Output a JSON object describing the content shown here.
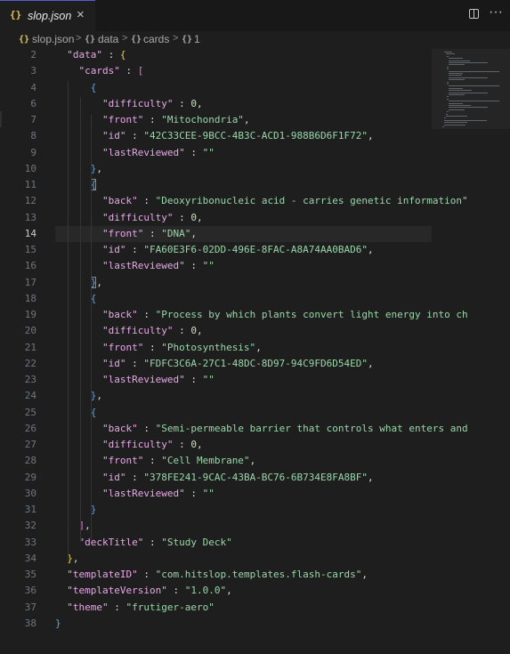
{
  "tab": {
    "icon": "{}",
    "label": "slop.json",
    "close_glyph": "×"
  },
  "toolbar": {
    "split_editor_icon": "split-editor-icon",
    "more_actions_glyph": "···"
  },
  "breadcrumb": {
    "file": "slop.json",
    "items": [
      "data",
      "cards",
      "1"
    ],
    "separator": ">",
    "object_icon": "{}"
  },
  "editor": {
    "active_line": 14,
    "lines": [
      {
        "n": "2",
        "tokens": [
          {
            "t": "  ",
            "c": "p"
          },
          {
            "t": "\"data\"",
            "c": "k"
          },
          {
            "t": " : ",
            "c": "p"
          },
          {
            "t": "{",
            "c": "g1"
          }
        ]
      },
      {
        "n": "3",
        "tokens": [
          {
            "t": "    ",
            "c": "p"
          },
          {
            "t": "\"cards\"",
            "c": "k"
          },
          {
            "t": " : ",
            "c": "p"
          },
          {
            "t": "[",
            "c": "g2"
          }
        ]
      },
      {
        "n": "4",
        "tokens": [
          {
            "t": "      ",
            "c": "p"
          },
          {
            "t": "{",
            "c": "g3"
          }
        ]
      },
      {
        "n": "6",
        "tokens": [
          {
            "t": "        ",
            "c": "p"
          },
          {
            "t": "\"difficulty\"",
            "c": "k"
          },
          {
            "t": " : ",
            "c": "p"
          },
          {
            "t": "0",
            "c": "n"
          },
          {
            "t": ",",
            "c": "p"
          }
        ]
      },
      {
        "n": "7",
        "tokens": [
          {
            "t": "        ",
            "c": "p"
          },
          {
            "t": "\"front\"",
            "c": "k"
          },
          {
            "t": " : ",
            "c": "p"
          },
          {
            "t": "\"Mitochondria\"",
            "c": "s"
          },
          {
            "t": ",",
            "c": "p"
          }
        ]
      },
      {
        "n": "8",
        "tokens": [
          {
            "t": "        ",
            "c": "p"
          },
          {
            "t": "\"id\"",
            "c": "k"
          },
          {
            "t": " : ",
            "c": "p"
          },
          {
            "t": "\"42C33CEE-9BCC-4B3C-ACD1-988B6D6F1F72\"",
            "c": "s"
          },
          {
            "t": ",",
            "c": "p"
          }
        ]
      },
      {
        "n": "9",
        "tokens": [
          {
            "t": "        ",
            "c": "p"
          },
          {
            "t": "\"lastReviewed\"",
            "c": "k"
          },
          {
            "t": " : ",
            "c": "p"
          },
          {
            "t": "\"\"",
            "c": "s"
          }
        ]
      },
      {
        "n": "10",
        "tokens": [
          {
            "t": "      ",
            "c": "p"
          },
          {
            "t": "}",
            "c": "g3"
          },
          {
            "t": ",",
            "c": "p"
          }
        ]
      },
      {
        "n": "11",
        "tokens": [
          {
            "t": "      ",
            "c": "p"
          },
          {
            "t": "{",
            "c": "g3 bm"
          }
        ]
      },
      {
        "n": "12",
        "tokens": [
          {
            "t": "        ",
            "c": "p"
          },
          {
            "t": "\"back\"",
            "c": "k"
          },
          {
            "t": " : ",
            "c": "p"
          },
          {
            "t": "\"Deoxyribonucleic acid - carries genetic information\"",
            "c": "s"
          }
        ]
      },
      {
        "n": "13",
        "tokens": [
          {
            "t": "        ",
            "c": "p"
          },
          {
            "t": "\"difficulty\"",
            "c": "k"
          },
          {
            "t": " : ",
            "c": "p"
          },
          {
            "t": "0",
            "c": "n"
          },
          {
            "t": ",",
            "c": "p"
          }
        ]
      },
      {
        "n": "14",
        "tokens": [
          {
            "t": "        ",
            "c": "p"
          },
          {
            "t": "\"front\"",
            "c": "k"
          },
          {
            "t": " : ",
            "c": "p"
          },
          {
            "t": "\"DNA\"",
            "c": "s"
          },
          {
            "t": ",",
            "c": "p"
          }
        ]
      },
      {
        "n": "15",
        "tokens": [
          {
            "t": "        ",
            "c": "p"
          },
          {
            "t": "\"id\"",
            "c": "k"
          },
          {
            "t": " : ",
            "c": "p"
          },
          {
            "t": "\"FA60E3F6-02DD-496E-8FAC-A8A74AA0BAD6\"",
            "c": "s"
          },
          {
            "t": ",",
            "c": "p"
          }
        ]
      },
      {
        "n": "16",
        "tokens": [
          {
            "t": "        ",
            "c": "p"
          },
          {
            "t": "\"lastReviewed\"",
            "c": "k"
          },
          {
            "t": " : ",
            "c": "p"
          },
          {
            "t": "\"\"",
            "c": "s"
          }
        ]
      },
      {
        "n": "17",
        "tokens": [
          {
            "t": "      ",
            "c": "p"
          },
          {
            "t": "}",
            "c": "g3 bm"
          },
          {
            "t": ",",
            "c": "p"
          }
        ]
      },
      {
        "n": "18",
        "tokens": [
          {
            "t": "      ",
            "c": "p"
          },
          {
            "t": "{",
            "c": "g3"
          }
        ]
      },
      {
        "n": "19",
        "tokens": [
          {
            "t": "        ",
            "c": "p"
          },
          {
            "t": "\"back\"",
            "c": "k"
          },
          {
            "t": " : ",
            "c": "p"
          },
          {
            "t": "\"Process by which plants convert light energy into ch",
            "c": "s"
          }
        ]
      },
      {
        "n": "20",
        "tokens": [
          {
            "t": "        ",
            "c": "p"
          },
          {
            "t": "\"difficulty\"",
            "c": "k"
          },
          {
            "t": " : ",
            "c": "p"
          },
          {
            "t": "0",
            "c": "n"
          },
          {
            "t": ",",
            "c": "p"
          }
        ]
      },
      {
        "n": "21",
        "tokens": [
          {
            "t": "        ",
            "c": "p"
          },
          {
            "t": "\"front\"",
            "c": "k"
          },
          {
            "t": " : ",
            "c": "p"
          },
          {
            "t": "\"Photosynthesis\"",
            "c": "s"
          },
          {
            "t": ",",
            "c": "p"
          }
        ]
      },
      {
        "n": "22",
        "tokens": [
          {
            "t": "        ",
            "c": "p"
          },
          {
            "t": "\"id\"",
            "c": "k"
          },
          {
            "t": " : ",
            "c": "p"
          },
          {
            "t": "\"FDFC3C6A-27C1-48DC-8D97-94C9FD6D54ED\"",
            "c": "s"
          },
          {
            "t": ",",
            "c": "p"
          }
        ]
      },
      {
        "n": "23",
        "tokens": [
          {
            "t": "        ",
            "c": "p"
          },
          {
            "t": "\"lastReviewed\"",
            "c": "k"
          },
          {
            "t": " : ",
            "c": "p"
          },
          {
            "t": "\"\"",
            "c": "s"
          }
        ]
      },
      {
        "n": "24",
        "tokens": [
          {
            "t": "      ",
            "c": "p"
          },
          {
            "t": "}",
            "c": "g3"
          },
          {
            "t": ",",
            "c": "p"
          }
        ]
      },
      {
        "n": "25",
        "tokens": [
          {
            "t": "      ",
            "c": "p"
          },
          {
            "t": "{",
            "c": "g3"
          }
        ]
      },
      {
        "n": "26",
        "tokens": [
          {
            "t": "        ",
            "c": "p"
          },
          {
            "t": "\"back\"",
            "c": "k"
          },
          {
            "t": " : ",
            "c": "p"
          },
          {
            "t": "\"Semi-permeable barrier that controls what enters and",
            "c": "s"
          }
        ]
      },
      {
        "n": "27",
        "tokens": [
          {
            "t": "        ",
            "c": "p"
          },
          {
            "t": "\"difficulty\"",
            "c": "k"
          },
          {
            "t": " : ",
            "c": "p"
          },
          {
            "t": "0",
            "c": "n"
          },
          {
            "t": ",",
            "c": "p"
          }
        ]
      },
      {
        "n": "28",
        "tokens": [
          {
            "t": "        ",
            "c": "p"
          },
          {
            "t": "\"front\"",
            "c": "k"
          },
          {
            "t": " : ",
            "c": "p"
          },
          {
            "t": "\"Cell Membrane\"",
            "c": "s"
          },
          {
            "t": ",",
            "c": "p"
          }
        ]
      },
      {
        "n": "29",
        "tokens": [
          {
            "t": "        ",
            "c": "p"
          },
          {
            "t": "\"id\"",
            "c": "k"
          },
          {
            "t": " : ",
            "c": "p"
          },
          {
            "t": "\"378FE241-9CAC-43BA-BC76-6B734E8FA8BF\"",
            "c": "s"
          },
          {
            "t": ",",
            "c": "p"
          }
        ]
      },
      {
        "n": "30",
        "tokens": [
          {
            "t": "        ",
            "c": "p"
          },
          {
            "t": "\"lastReviewed\"",
            "c": "k"
          },
          {
            "t": " : ",
            "c": "p"
          },
          {
            "t": "\"\"",
            "c": "s"
          }
        ]
      },
      {
        "n": "31",
        "tokens": [
          {
            "t": "      ",
            "c": "p"
          },
          {
            "t": "}",
            "c": "g3"
          }
        ]
      },
      {
        "n": "32",
        "tokens": [
          {
            "t": "    ",
            "c": "p"
          },
          {
            "t": "]",
            "c": "g2"
          },
          {
            "t": ",",
            "c": "p"
          }
        ]
      },
      {
        "n": "33",
        "tokens": [
          {
            "t": "    ",
            "c": "p"
          },
          {
            "t": "\"deckTitle\"",
            "c": "k"
          },
          {
            "t": " : ",
            "c": "p"
          },
          {
            "t": "\"Study Deck\"",
            "c": "s"
          }
        ]
      },
      {
        "n": "34",
        "tokens": [
          {
            "t": "  ",
            "c": "p"
          },
          {
            "t": "}",
            "c": "g1"
          },
          {
            "t": ",",
            "c": "p"
          }
        ]
      },
      {
        "n": "35",
        "tokens": [
          {
            "t": "  ",
            "c": "p"
          },
          {
            "t": "\"templateID\"",
            "c": "k"
          },
          {
            "t": " : ",
            "c": "p"
          },
          {
            "t": "\"com.hitslop.templates.flash-cards\"",
            "c": "s"
          },
          {
            "t": ",",
            "c": "p"
          }
        ]
      },
      {
        "n": "36",
        "tokens": [
          {
            "t": "  ",
            "c": "p"
          },
          {
            "t": "\"templateVersion\"",
            "c": "k"
          },
          {
            "t": " : ",
            "c": "p"
          },
          {
            "t": "\"1.0.0\"",
            "c": "s"
          },
          {
            "t": ",",
            "c": "p"
          }
        ]
      },
      {
        "n": "37",
        "tokens": [
          {
            "t": "  ",
            "c": "p"
          },
          {
            "t": "\"theme\"",
            "c": "k"
          },
          {
            "t": " : ",
            "c": "p"
          },
          {
            "t": "\"frutiger-aero\"",
            "c": "s"
          }
        ]
      },
      {
        "n": "38",
        "tokens": [
          {
            "t": "",
            "c": "p"
          },
          {
            "t": "}",
            "c": "g3"
          }
        ]
      }
    ]
  },
  "colors": {
    "key": "#e7a8e6",
    "string": "#99d7a9",
    "number": "#c8e0b4",
    "bracket_level1": "#e6c85a",
    "bracket_level2": "#d77ad6",
    "bracket_level3": "#5aa6e6",
    "tab_accent": "#5a5ad6",
    "json_icon": "#e3c35a"
  }
}
